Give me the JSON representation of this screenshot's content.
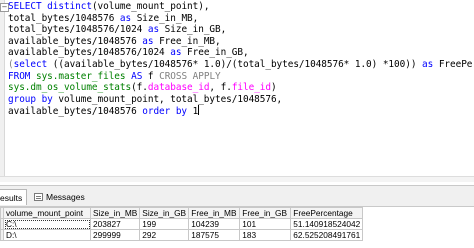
{
  "editor": {
    "collapse_symbol": "−",
    "lines": [
      [
        {
          "t": "SELECT ",
          "c": "kw"
        },
        {
          "t": "distinct",
          "c": "kw"
        },
        {
          "t": "(volume_mount_point),",
          "c": "tx"
        }
      ],
      [
        {
          "t": "total_bytes/1048576 ",
          "c": "tx"
        },
        {
          "t": "as",
          "c": "kw"
        },
        {
          "t": " Size_in_MB,",
          "c": "tx"
        }
      ],
      [
        {
          "t": "total_bytes/1048576/1024 ",
          "c": "tx"
        },
        {
          "t": "as",
          "c": "kw"
        },
        {
          "t": " Size_in_GB,",
          "c": "tx"
        }
      ],
      [
        {
          "t": "available_bytes/1048576 ",
          "c": "tx"
        },
        {
          "t": "as",
          "c": "kw"
        },
        {
          "t": " Free_in_MB,",
          "c": "tx"
        }
      ],
      [
        {
          "t": "available_bytes/1048576/1024 ",
          "c": "tx"
        },
        {
          "t": "as",
          "c": "kw"
        },
        {
          "t": " Free_in_GB,",
          "c": "tx"
        }
      ],
      [
        {
          "t": "(",
          "c": "gr"
        },
        {
          "t": "select",
          "c": "kw"
        },
        {
          "t": " ((available_bytes/1048576* 1.0)/(total_bytes/1048576* 1.0) *100)) ",
          "c": "tx"
        },
        {
          "t": "as",
          "c": "kw"
        },
        {
          "t": " FreePercentage",
          "c": "tx"
        }
      ],
      [
        {
          "t": "FROM ",
          "c": "kw"
        },
        {
          "t": "sys.master_files ",
          "c": "sys"
        },
        {
          "t": "AS",
          "c": "kw"
        },
        {
          "t": " f ",
          "c": "tx"
        },
        {
          "t": "CROSS APPLY",
          "c": "gr"
        }
      ],
      [
        {
          "t": "sys.dm_os_volume_stats",
          "c": "sys"
        },
        {
          "t": "(f.",
          "c": "tx"
        },
        {
          "t": "database_id",
          "c": "fn"
        },
        {
          "t": ", f.",
          "c": "tx"
        },
        {
          "t": "file_id",
          "c": "fn"
        },
        {
          "t": ")",
          "c": "tx"
        }
      ],
      [
        {
          "t": "group by",
          "c": "kw"
        },
        {
          "t": " volume_mount_point, total_bytes/1048576,",
          "c": "tx"
        }
      ],
      [
        {
          "t": "available_bytes/1048576 ",
          "c": "tx"
        },
        {
          "t": "order by",
          "c": "kw"
        },
        {
          "t": " 1",
          "c": "tx"
        },
        {
          "t": "",
          "c": "cursor"
        }
      ]
    ]
  },
  "tabs": {
    "results_label": "esults",
    "messages_label": "Messages"
  },
  "grid": {
    "columns": [
      "volume_mount_point",
      "Size_in_MB",
      "Size_in_GB",
      "Free_in_MB",
      "Free_in_GB",
      "FreePercentage"
    ],
    "rows": [
      [
        "C:\\",
        "203827",
        "199",
        "104239",
        "101",
        "51.1409185240​42"
      ],
      [
        "D:\\",
        "299999",
        "292",
        "187575",
        "183",
        "62.5252084917​61"
      ]
    ]
  }
}
